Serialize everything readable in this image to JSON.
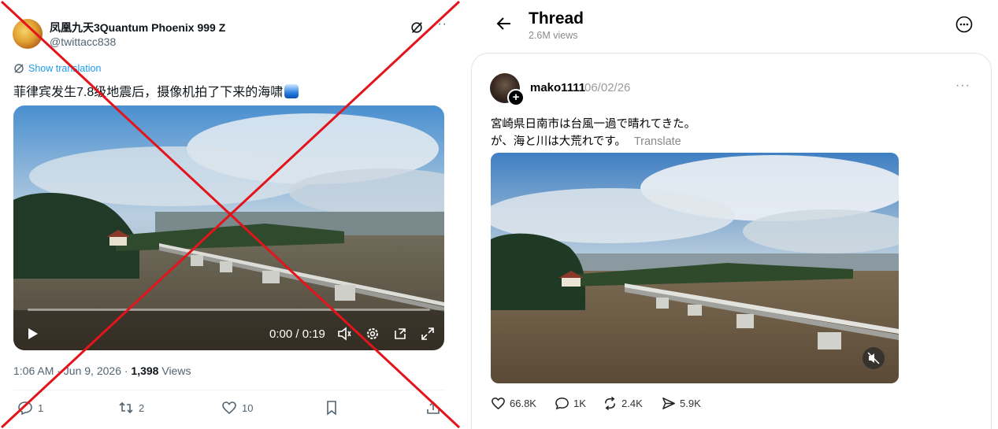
{
  "left_post": {
    "display_name": "凤凰九天3Quantum Phoenix 999 Z",
    "handle": "@twittacc838",
    "show_translation": "Show translation",
    "text": "菲律宾发生7.8级地震后，摄像机拍了下来的海啸",
    "video_time": "0:00 / 0:19",
    "video_progress": 0.0,
    "timestamp": "1:06 AM · Jun 9, 2026 · ",
    "views_count": "1,398",
    "views_label": " Views",
    "replies": "1",
    "reposts": "2",
    "likes": "10"
  },
  "right_post": {
    "header_title": "Thread",
    "header_views": "2.6M views",
    "username": "mako1111",
    "date": "06/02/26",
    "line1": "宮崎県日南市は台風一過で晴れてきた。",
    "line2": "が、海と川は大荒れです。",
    "translate": "Translate",
    "likes": "66.8K",
    "replies": "1K",
    "reposts": "2.4K",
    "shares": "5.9K"
  },
  "colors": {
    "link_blue": "#1d9bf0",
    "cross_red": "#e3141b",
    "muted_gray": "#536471"
  },
  "icons": [
    "grok-icon",
    "more-icon",
    "translate-icon",
    "play-icon",
    "volume-icon",
    "settings-icon",
    "pip-icon",
    "fullscreen-icon",
    "reply-icon",
    "repost-icon",
    "like-icon",
    "bookmark-icon",
    "share-icon",
    "back-arrow-icon",
    "more-circle-icon",
    "mute-icon",
    "send-icon"
  ]
}
